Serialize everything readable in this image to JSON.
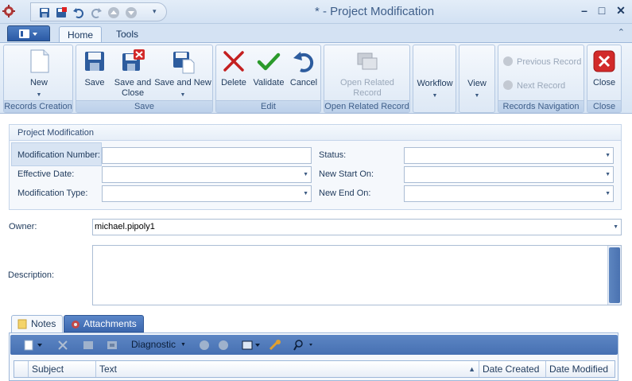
{
  "window": {
    "title": "*  - Project Modification",
    "controls": {
      "minimize": "–",
      "maximize": "□",
      "close": "✕"
    }
  },
  "quick_access": {
    "icons": [
      "save-icon",
      "save-close-icon",
      "undo-icon",
      "redo-icon",
      "up-icon",
      "down-icon"
    ],
    "more": "▾"
  },
  "ribbon": {
    "tabs": [
      {
        "label": "Home"
      },
      {
        "label": "Tools"
      }
    ],
    "collapse": "⌃",
    "groups": {
      "records_creation": {
        "label": "Records Creation",
        "new": "New"
      },
      "save": {
        "label": "Save",
        "save": "Save",
        "save_close_1": "Save and",
        "save_close_2": "Close",
        "save_new": "Save and New"
      },
      "edit": {
        "label": "Edit",
        "delete": "Delete",
        "validate": "Validate",
        "cancel": "Cancel"
      },
      "open_related": {
        "label": "Open Related Record",
        "btn_1": "Open Related",
        "btn_2": "Record"
      },
      "workflow": {
        "label": "Workflow"
      },
      "view": {
        "label": "View"
      },
      "navigation": {
        "label": "Records Navigation",
        "previous": "Previous Record",
        "next": "Next Record"
      },
      "close": {
        "label": "Close",
        "close": "Close"
      }
    }
  },
  "form": {
    "section_title": "Project Modification",
    "fields": {
      "modification_number": {
        "label": "Modification Number:",
        "value": ""
      },
      "status": {
        "label": "Status:",
        "value": ""
      },
      "effective_date": {
        "label": "Effective Date:",
        "value": ""
      },
      "new_start_on": {
        "label": "New Start On:",
        "value": ""
      },
      "modification_type": {
        "label": "Modification Type:",
        "value": ""
      },
      "new_end_on": {
        "label": "New End On:",
        "value": ""
      }
    },
    "owner": {
      "label": "Owner:",
      "value": "michael.pipoly1"
    },
    "description": {
      "label": "Description:",
      "value": ""
    }
  },
  "bottom_tabs": [
    {
      "label": "Notes"
    },
    {
      "label": "Attachments"
    }
  ],
  "notes_grid": {
    "toolbar": {
      "diagnostic": "Diagnostic"
    },
    "columns": [
      "Subject",
      "Text",
      "Date Created",
      "Date Modified"
    ],
    "sort_indicator": "▲"
  }
}
